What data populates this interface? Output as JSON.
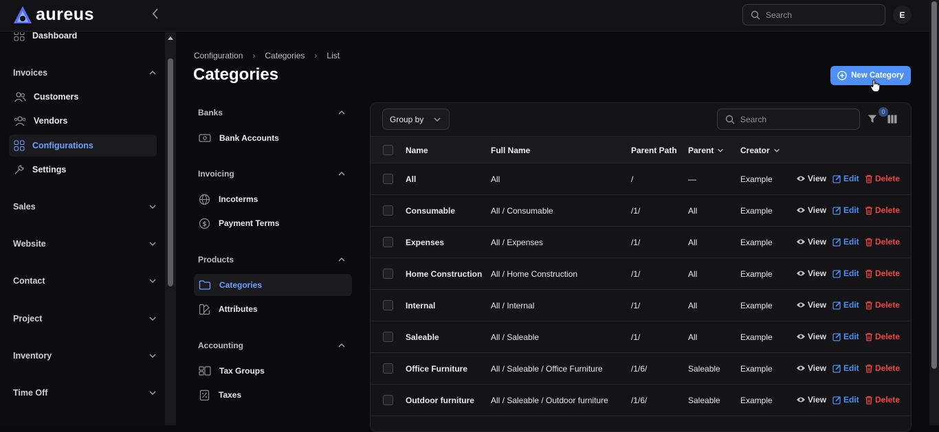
{
  "app": {
    "name": "aureus"
  },
  "topbar": {
    "search_placeholder": "Search",
    "avatar_initial": "E"
  },
  "sidebar": {
    "dashboard": "Dashboard",
    "invoices_group": "Invoices",
    "customers": "Customers",
    "vendors": "Vendors",
    "configurations": "Configurations",
    "settings": "Settings",
    "groups": [
      "Sales",
      "Website",
      "Contact",
      "Project",
      "Inventory",
      "Time Off"
    ]
  },
  "breadcrumb": [
    "Configuration",
    "Categories",
    "List"
  ],
  "page": {
    "title": "Categories",
    "new_button": "New Category"
  },
  "subnav": {
    "banks": {
      "label": "Banks",
      "items": [
        "Bank Accounts"
      ]
    },
    "invoicing": {
      "label": "Invoicing",
      "items": [
        "Incoterms",
        "Payment Terms"
      ]
    },
    "products": {
      "label": "Products",
      "items": [
        "Categories",
        "Attributes"
      ]
    },
    "accounting": {
      "label": "Accounting",
      "items": [
        "Tax Groups",
        "Taxes"
      ]
    }
  },
  "table": {
    "group_by": "Group by",
    "search_placeholder": "Search",
    "filter_count": "0",
    "columns": [
      "Name",
      "Full Name",
      "Parent Path",
      "Parent",
      "Creator"
    ],
    "actions": {
      "view": "View",
      "edit": "Edit",
      "delete": "Delete"
    },
    "rows": [
      {
        "name": "All",
        "full_name": "All",
        "parent_path": "/",
        "parent": "—",
        "creator": "Example"
      },
      {
        "name": "Consumable",
        "full_name": "All / Consumable",
        "parent_path": "/1/",
        "parent": "All",
        "creator": "Example"
      },
      {
        "name": "Expenses",
        "full_name": "All / Expenses",
        "parent_path": "/1/",
        "parent": "All",
        "creator": "Example"
      },
      {
        "name": "Home Construction",
        "full_name": "All / Home Construction",
        "parent_path": "/1/",
        "parent": "All",
        "creator": "Example"
      },
      {
        "name": "Internal",
        "full_name": "All / Internal",
        "parent_path": "/1/",
        "parent": "All",
        "creator": "Example"
      },
      {
        "name": "Saleable",
        "full_name": "All / Saleable",
        "parent_path": "/1/",
        "parent": "All",
        "creator": "Example"
      },
      {
        "name": "Office Furniture",
        "full_name": "All / Saleable / Office Furniture",
        "parent_path": "/1/6/",
        "parent": "Saleable",
        "creator": "Example"
      },
      {
        "name": "Outdoor furniture",
        "full_name": "All / Saleable / Outdoor furniture",
        "parent_path": "/1/6/",
        "parent": "Saleable",
        "creator": "Example"
      }
    ]
  },
  "colors": {
    "accent": "#4d8ff4",
    "danger": "#ef4444",
    "active_text": "#6aa2ff"
  }
}
